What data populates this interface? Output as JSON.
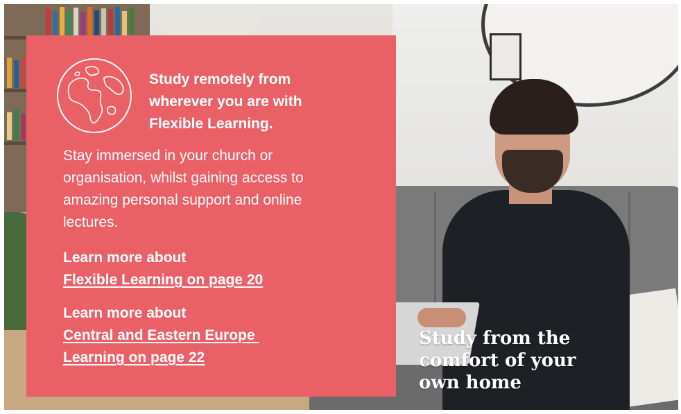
{
  "panel": {
    "heading_lines": [
      "Study remotely from",
      "wherever you are with",
      "Flexible Learning."
    ],
    "body_lines": [
      "Stay immersed in your church or",
      "organisation, whilst gaining access to",
      "amazing personal support and online",
      "lectures."
    ],
    "links": [
      {
        "intro": "Learn more about",
        "link_lines": [
          "Flexible Learning on page 20"
        ]
      },
      {
        "intro": "Learn more about",
        "link_lines": [
          "Central and Eastern Europe ",
          "Learning on page 22"
        ]
      }
    ],
    "icon": "globe-icon",
    "background_color": "#e96067"
  },
  "photo": {
    "caption_lines": [
      "Study from the",
      "comfort of your",
      "own home"
    ]
  }
}
